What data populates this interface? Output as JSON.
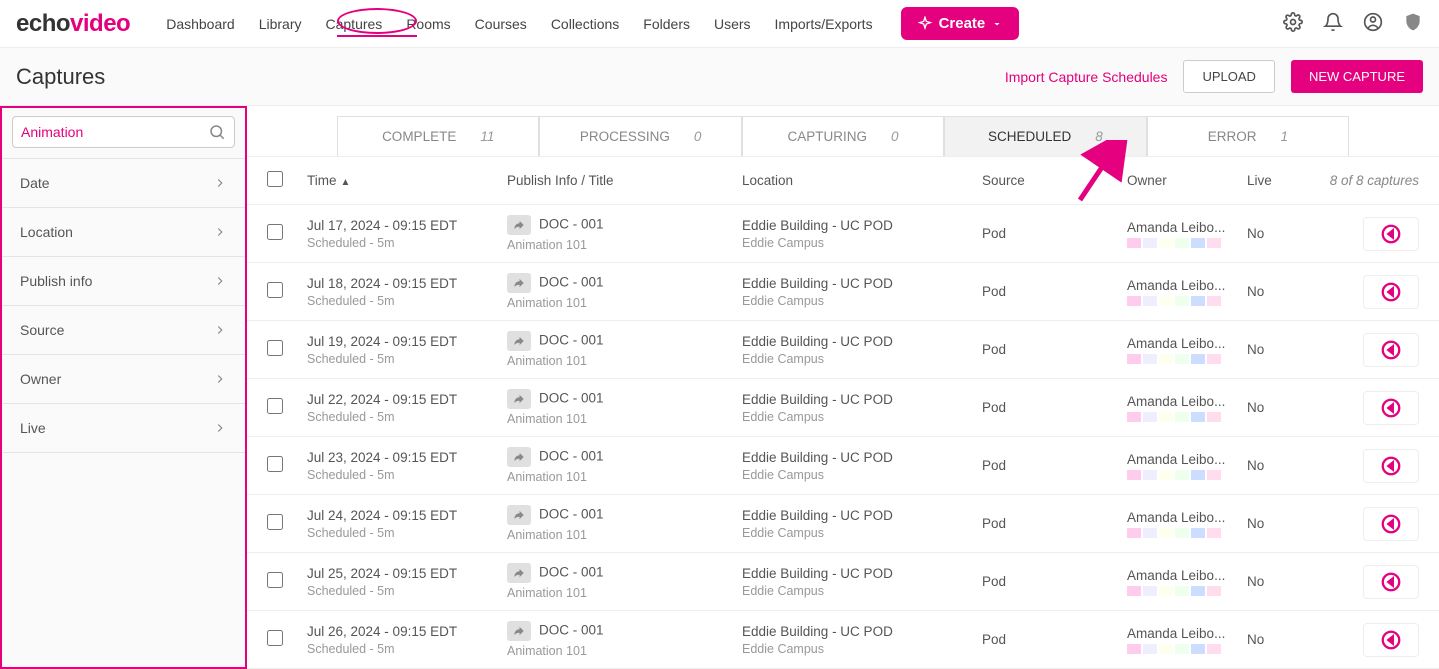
{
  "logo": {
    "part1": "echo",
    "part2": "video"
  },
  "nav": [
    "Dashboard",
    "Library",
    "Captures",
    "Rooms",
    "Courses",
    "Collections",
    "Folders",
    "Users",
    "Imports/Exports"
  ],
  "create_label": "Create",
  "page_title": "Captures",
  "subheader": {
    "import_link": "Import Capture Schedules",
    "upload": "UPLOAD",
    "new_capture": "NEW CAPTURE"
  },
  "search_value": "Animation",
  "filters": [
    "Date",
    "Location",
    "Publish info",
    "Source",
    "Owner",
    "Live"
  ],
  "tabs": [
    {
      "label": "COMPLETE",
      "count": "11"
    },
    {
      "label": "PROCESSING",
      "count": "0"
    },
    {
      "label": "CAPTURING",
      "count": "0"
    },
    {
      "label": "SCHEDULED",
      "count": "8"
    },
    {
      "label": "ERROR",
      "count": "1"
    }
  ],
  "columns": {
    "time": "Time",
    "publish": "Publish Info / Title",
    "location": "Location",
    "source": "Source",
    "owner": "Owner",
    "live": "Live",
    "summary": "8 of 8 captures"
  },
  "rows": [
    {
      "time": "Jul 17, 2024 - 09:15 EDT",
      "status": "Scheduled - 5m",
      "doc": "DOC - 001",
      "course": "Animation 101",
      "loc1": "Eddie Building - UC POD",
      "loc2": "Eddie Campus",
      "source": "Pod",
      "owner": "Amanda Leibo...",
      "live": "No"
    },
    {
      "time": "Jul 18, 2024 - 09:15 EDT",
      "status": "Scheduled - 5m",
      "doc": "DOC - 001",
      "course": "Animation 101",
      "loc1": "Eddie Building - UC POD",
      "loc2": "Eddie Campus",
      "source": "Pod",
      "owner": "Amanda Leibo...",
      "live": "No"
    },
    {
      "time": "Jul 19, 2024 - 09:15 EDT",
      "status": "Scheduled - 5m",
      "doc": "DOC - 001",
      "course": "Animation 101",
      "loc1": "Eddie Building - UC POD",
      "loc2": "Eddie Campus",
      "source": "Pod",
      "owner": "Amanda Leibo...",
      "live": "No"
    },
    {
      "time": "Jul 22, 2024 - 09:15 EDT",
      "status": "Scheduled - 5m",
      "doc": "DOC - 001",
      "course": "Animation 101",
      "loc1": "Eddie Building - UC POD",
      "loc2": "Eddie Campus",
      "source": "Pod",
      "owner": "Amanda Leibo...",
      "live": "No"
    },
    {
      "time": "Jul 23, 2024 - 09:15 EDT",
      "status": "Scheduled - 5m",
      "doc": "DOC - 001",
      "course": "Animation 101",
      "loc1": "Eddie Building - UC POD",
      "loc2": "Eddie Campus",
      "source": "Pod",
      "owner": "Amanda Leibo...",
      "live": "No"
    },
    {
      "time": "Jul 24, 2024 - 09:15 EDT",
      "status": "Scheduled - 5m",
      "doc": "DOC - 001",
      "course": "Animation 101",
      "loc1": "Eddie Building - UC POD",
      "loc2": "Eddie Campus",
      "source": "Pod",
      "owner": "Amanda Leibo...",
      "live": "No"
    },
    {
      "time": "Jul 25, 2024 - 09:15 EDT",
      "status": "Scheduled - 5m",
      "doc": "DOC - 001",
      "course": "Animation 101",
      "loc1": "Eddie Building - UC POD",
      "loc2": "Eddie Campus",
      "source": "Pod",
      "owner": "Amanda Leibo...",
      "live": "No"
    },
    {
      "time": "Jul 26, 2024 - 09:15 EDT",
      "status": "Scheduled - 5m",
      "doc": "DOC - 001",
      "course": "Animation 101",
      "loc1": "Eddie Building - UC POD",
      "loc2": "Eddie Campus",
      "source": "Pod",
      "owner": "Amanda Leibo...",
      "live": "No"
    }
  ]
}
